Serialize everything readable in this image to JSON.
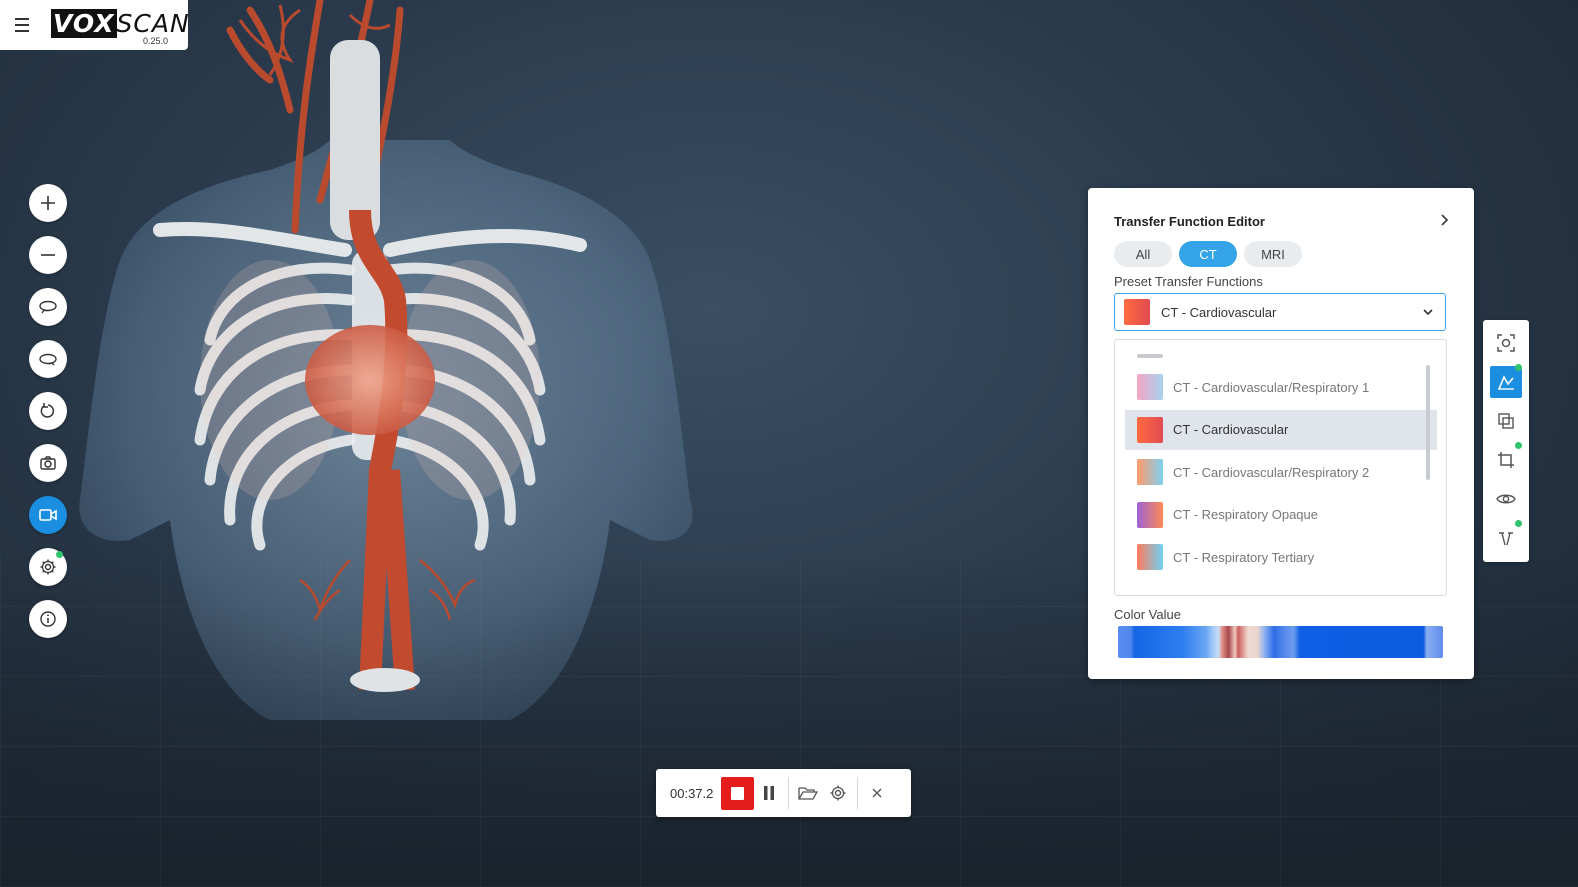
{
  "app": {
    "logo_text": "VOXSCAN",
    "logo_bold": "VOX",
    "logo_rest": "SCAN",
    "version": "0.25.0"
  },
  "left_toolbar": {
    "items": [
      {
        "name": "zoom-in",
        "icon": "plus-icon"
      },
      {
        "name": "zoom-out",
        "icon": "minus-icon"
      },
      {
        "name": "rotate-horizontal",
        "icon": "orbit-icon"
      },
      {
        "name": "rotate-vertical",
        "icon": "orbit-alt-icon"
      },
      {
        "name": "reset-view",
        "icon": "undo-icon"
      },
      {
        "name": "screenshot",
        "icon": "camera-icon"
      },
      {
        "name": "record-video",
        "icon": "video-icon",
        "active": true
      },
      {
        "name": "settings",
        "icon": "gear-icon",
        "badge": true
      },
      {
        "name": "info",
        "icon": "info-icon"
      }
    ]
  },
  "transfer_function_editor": {
    "title": "Transfer Function Editor",
    "tabs": [
      {
        "label": "All",
        "active": false
      },
      {
        "label": "CT",
        "active": true
      },
      {
        "label": "MRI",
        "active": false
      }
    ],
    "preset_label": "Preset Transfer Functions",
    "selected_preset": "CT - Cardiovascular",
    "dropdown_options": [
      {
        "label": "CT - Cardiovascular/Respiratory 1",
        "colors": [
          "#f3a6c4",
          "#a6d2f0"
        ]
      },
      {
        "label": "CT - Cardiovascular",
        "colors": [
          "#ff6b3d",
          "#e04b52"
        ],
        "selected": true
      },
      {
        "label": "CT - Cardiovascular/Respiratory 2",
        "colors": [
          "#ff9a6a",
          "#7fd0f0"
        ]
      },
      {
        "label": "CT - Respiratory Opaque",
        "colors": [
          "#9d63d6",
          "#ff8a55"
        ]
      },
      {
        "label": "CT - Respiratory Tertiary",
        "colors": [
          "#ff7a5c",
          "#6fd3f3"
        ]
      }
    ],
    "color_value_label": "Color Value"
  },
  "right_toolbar": {
    "items": [
      {
        "name": "focus",
        "icon": "focus-scan-icon"
      },
      {
        "name": "transfer-function",
        "icon": "histogram-icon",
        "active": true,
        "badge": true
      },
      {
        "name": "layers",
        "icon": "layers-icon"
      },
      {
        "name": "crop",
        "icon": "crop-icon",
        "badge": true
      },
      {
        "name": "visibility",
        "icon": "eye-icon"
      },
      {
        "name": "segmentation",
        "icon": "cut-icon",
        "badge": true
      }
    ]
  },
  "recording_bar": {
    "time": "00:37.2",
    "buttons": [
      "stop",
      "pause",
      "open-folder",
      "settings",
      "close"
    ]
  },
  "colors": {
    "accent": "#35a3e8",
    "active_tool": "#1b8ee0",
    "record": "#e41c1c",
    "badge": "#2ec36c"
  }
}
